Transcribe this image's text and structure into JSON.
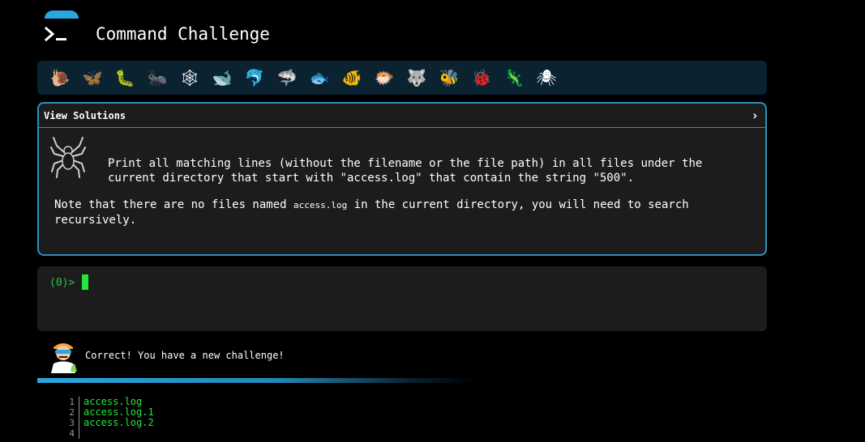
{
  "header": {
    "title": "Command Challenge",
    "logo_icon": "terminal-prompt-icon",
    "accent_color": "#2aa6e0"
  },
  "levels": [
    {
      "name": "snail",
      "glyph": "🐌"
    },
    {
      "name": "butterfly",
      "glyph": "🦋"
    },
    {
      "name": "caterpillar",
      "glyph": "🐛"
    },
    {
      "name": "ant",
      "glyph": "🐜"
    },
    {
      "name": "spider-web",
      "glyph": "🕸"
    },
    {
      "name": "whale",
      "glyph": "🐋"
    },
    {
      "name": "dolphin",
      "glyph": "🐬"
    },
    {
      "name": "shark",
      "glyph": "🦈"
    },
    {
      "name": "fish",
      "glyph": "🐟"
    },
    {
      "name": "tropical-fish",
      "glyph": "🐠"
    },
    {
      "name": "pufferfish",
      "glyph": "🐡"
    },
    {
      "name": "wolf",
      "glyph": "🐺"
    },
    {
      "name": "bee",
      "glyph": "🐝"
    },
    {
      "name": "ladybug",
      "glyph": "🐞"
    },
    {
      "name": "lizard",
      "glyph": "🦎"
    },
    {
      "name": "spider",
      "glyph": "🕷"
    }
  ],
  "challenge": {
    "view_solutions_label": "View Solutions",
    "chevron": "›",
    "icon": "spider-icon",
    "description": "Print all matching lines (without the filename or the file path) in all files under the current directory that start with \"access.log\" that contain the string \"500\".",
    "note_prefix": "Note that there are no files named ",
    "note_code": "access.log",
    "note_suffix": " in the current directory, you will need to search recursively."
  },
  "terminal": {
    "prompt": "(0)>",
    "input_value": "",
    "prompt_color": "#25c93a",
    "cursor_color": "#1ee83a"
  },
  "feedback": {
    "mascot_icon": "scientist-mascot-icon",
    "message": "Correct! You have a new challenge!"
  },
  "output": {
    "lines": [
      {
        "num": "1",
        "text": "access.log"
      },
      {
        "num": "2",
        "text": "access.log.1"
      },
      {
        "num": "3",
        "text": "access.log.2"
      },
      {
        "num": "4",
        "text": ""
      }
    ]
  }
}
